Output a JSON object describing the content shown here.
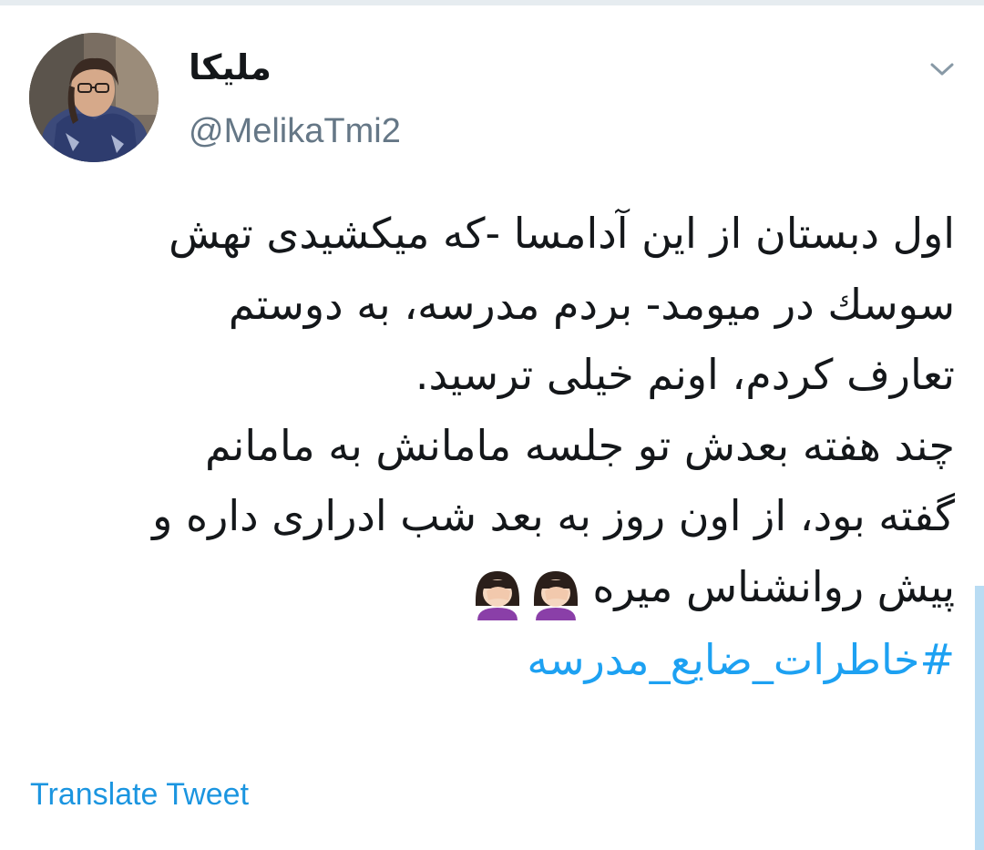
{
  "tweet": {
    "author": {
      "display_name": "ملیکا",
      "handle": "@MelikaTmi2",
      "avatar_icon": "profile-photo"
    },
    "menu_icon": "chevron-down-icon",
    "lines": [
      "اول دبستان از این آدامسا -که میکشیدی تهش",
      "سوسك در میومد- بردم مدرسه، به دوستم",
      "تعارف کردم، اونم خیلی ترسید.",
      "چند هفته بعدش تو جلسه مامانش به مامانم",
      "گفته بود، از اون روز به بعد شب ادراری داره و",
      "پیش روانشناس میره"
    ],
    "emojis": [
      "woman-facepalming-emoji",
      "woman-facepalming-emoji"
    ],
    "hashtag": "#خاطرات_ضایع_مدرسه",
    "translate_label": "Translate Tweet"
  },
  "colors": {
    "text": "#14171a",
    "secondary": "#657786",
    "link": "#1b95e0",
    "hashtag": "#1da1f2",
    "divider": "#e6ecf0"
  }
}
